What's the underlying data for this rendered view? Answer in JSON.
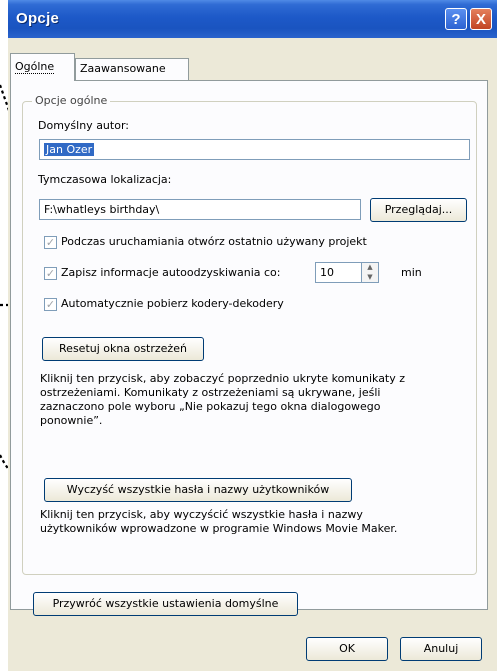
{
  "window": {
    "title": "Opcje",
    "help_glyph": "?",
    "close_glyph": "X"
  },
  "tabs": [
    {
      "label": "Ogólne"
    },
    {
      "label": "Zaawansowane"
    }
  ],
  "group": {
    "label": "Opcje ogólne"
  },
  "author": {
    "label": "Domyślny autor:",
    "value": "Jan Ozer"
  },
  "temp": {
    "label": "Tymczasowa lokalizacja:",
    "value": "F:\\whatleys birthday\\",
    "browse_label": "Przeglądaj..."
  },
  "options": {
    "open_last": "Podczas uruchamiania otwórz ostatnio używany projekt",
    "autosave": "Zapisz informacje autoodzyskiwania co:",
    "autosave_value": "10",
    "autosave_unit": "min",
    "download_codecs": "Automatycznie pobierz kodery-dekodery"
  },
  "reset_warnings": {
    "button": "Resetuj okna ostrzeżeń",
    "lines": [
      "Kliknij ten przycisk, aby zobaczyć poprzednio ukryte komunikaty z",
      "ostrzeżeniami. Komunikaty z ostrzeżeniami są ukrywane, jeśli",
      "zaznaczono pole wyboru „Nie pokazuj tego okna dialogowego",
      "ponownie”."
    ]
  },
  "clear_passwords": {
    "button": "Wyczyść wszystkie hasła i nazwy użytkowników",
    "lines": [
      "Kliknij ten przycisk, aby wyczyścić wszystkie hasła i nazwy",
      "użytkowników wprowadzone w programie Windows Movie Maker."
    ]
  },
  "restore_defaults": "Przywróć wszystkie ustawienia domyślne",
  "ok": "OK",
  "cancel": "Anuluj",
  "colors": {
    "titlebar": "#1d59c8",
    "dialog_bg": "#ece9d8",
    "panel_bg": "#fcfcfe",
    "selection": "#316ac5"
  }
}
